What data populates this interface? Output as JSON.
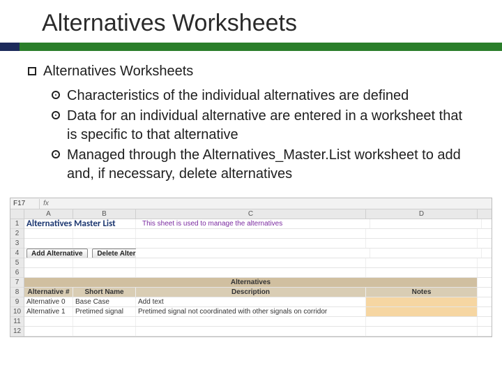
{
  "slide": {
    "title": "Alternatives Worksheets",
    "heading": "Alternatives Worksheets",
    "bullets": [
      "Characteristics of the individual alternatives are defined",
      "Data for an individual alternative are entered in a worksheet that is specific to that alternative",
      "Managed through the Alternatives_Master.List worksheet to add and, if necessary, delete alternatives"
    ]
  },
  "sheet": {
    "namebox": "F17",
    "fx": "fx",
    "columns": [
      "A",
      "B",
      "C",
      "D"
    ],
    "row_numbers": [
      "1",
      "2",
      "3",
      "4",
      "5",
      "6",
      "7",
      "8",
      "9",
      "10",
      "11",
      "12"
    ],
    "title": "Alternatives Master List",
    "instruction": "This sheet is used to manage the alternatives",
    "buttons": {
      "add": "Add Alternative",
      "delete": "Delete Alternative"
    },
    "band_title": "Alternatives",
    "col_labels": {
      "a": "Alternative #",
      "b": "Short Name",
      "c": "Description",
      "d": "Notes"
    },
    "rows": [
      {
        "a": "Alternative 0",
        "b": "Base Case",
        "c": "Add text",
        "d": ""
      },
      {
        "a": "Alternative 1",
        "b": "Pretimed signal",
        "c": "Pretimed signal not coordinated with other signals on corridor",
        "d": ""
      }
    ]
  }
}
